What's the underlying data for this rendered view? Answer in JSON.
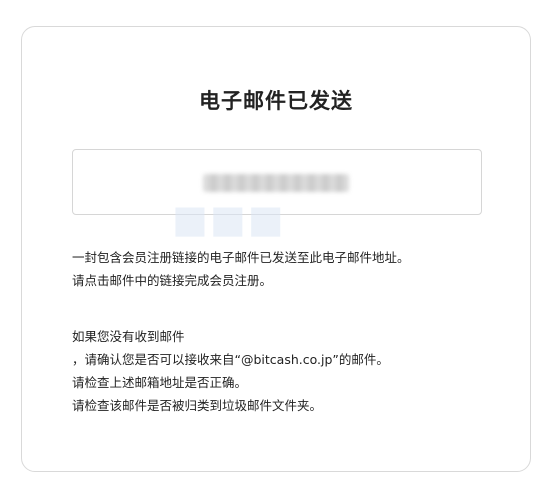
{
  "dialog": {
    "title": "电子邮件已发送",
    "email_value": ""
  },
  "message": {
    "line1": "一封包含会员注册链接的电子邮件已发送至此电子邮件地址。",
    "line2": "请点击邮件中的链接完成会员注册。"
  },
  "help": {
    "heading": "如果您没有收到邮件",
    "tip1": "，请确认您是否可以接收来自“@bitcash.co.jp”的邮件。",
    "tip2": "请检查上述邮箱地址是否正确。",
    "tip3": "请检查该邮件是否被归类到垃圾邮件文件夹。"
  }
}
